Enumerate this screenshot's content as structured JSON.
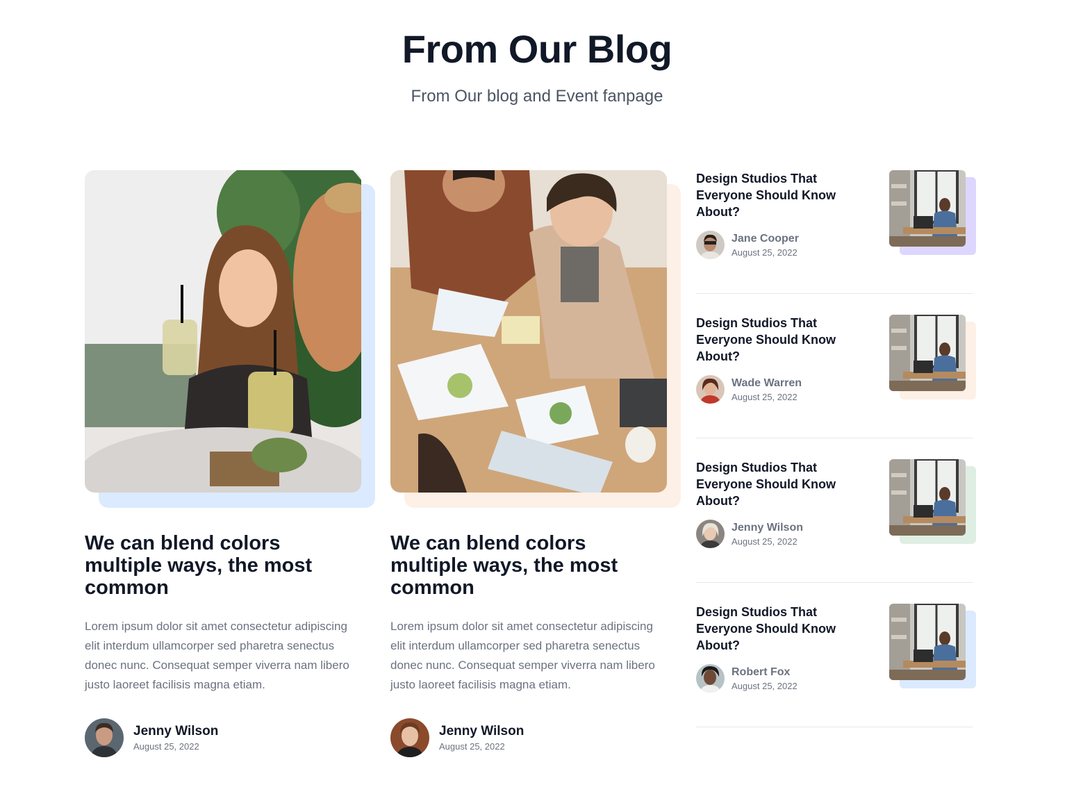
{
  "section": {
    "title": "From Our Blog",
    "subtitle": "From Our blog and Event fanpage"
  },
  "featured": [
    {
      "title": "We can blend colors multiple ways, the most common",
      "excerpt": "Lorem ipsum dolor sit amet consectetur adipiscing elit interdum ullamcorper sed pharetra senectus donec nunc. Consequat semper viverra nam libero justo laoreet facilisis magna etiam.",
      "author": "Jenny Wilson",
      "date": "August 25, 2022",
      "accent_color": "#dbeafe"
    },
    {
      "title": "We can blend colors multiple ways, the most common",
      "excerpt": "Lorem ipsum dolor sit amet consectetur adipiscing elit interdum ullamcorper sed pharetra senectus donec nunc. Consequat semper viverra nam libero justo laoreet facilisis magna etiam.",
      "author": "Jenny Wilson",
      "date": "August 25, 2022",
      "accent_color": "#fdf0e6"
    }
  ],
  "posts": [
    {
      "title": "Design Studios That Everyone Should Know About?",
      "author": "Jane Cooper",
      "date": "August 25, 2022",
      "accent_color": "#ddd6fe"
    },
    {
      "title": "Design Studios That Everyone Should Know About?",
      "author": "Wade Warren",
      "date": "August 25, 2022",
      "accent_color": "#fdf0e6"
    },
    {
      "title": "Design Studios That Everyone Should Know About?",
      "author": "Jenny Wilson",
      "date": "August 25, 2022",
      "accent_color": "#dfeee3"
    },
    {
      "title": "Design Studios That Everyone Should Know About?",
      "author": "Robert Fox",
      "date": "August 25, 2022",
      "accent_color": "#dbeafe"
    }
  ]
}
